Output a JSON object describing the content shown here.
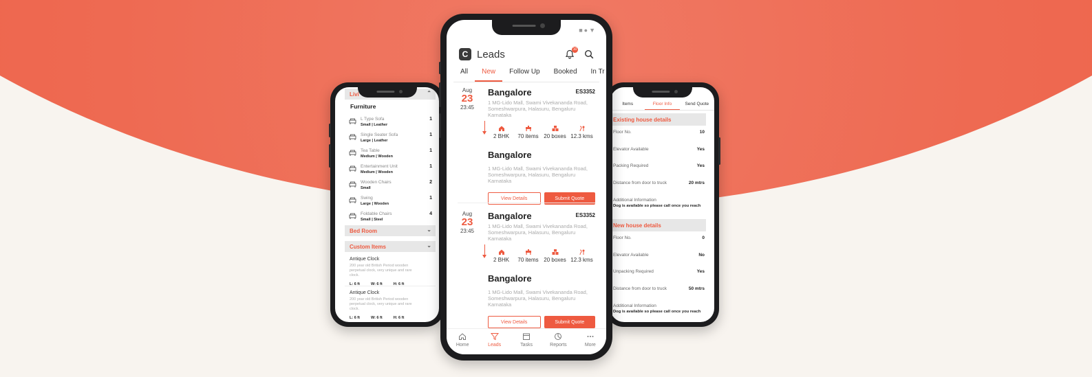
{
  "main": {
    "app_title": "Leads",
    "logo_letter": "C",
    "notification_count": "10",
    "tabs": [
      {
        "label": "All",
        "active": false
      },
      {
        "label": "New",
        "active": true
      },
      {
        "label": "Follow Up",
        "active": false
      },
      {
        "label": "Booked",
        "active": false
      },
      {
        "label": "In Tr",
        "active": false
      }
    ],
    "leads": [
      {
        "month": "Aug",
        "day": "23",
        "time": "23:45",
        "from_city": "Bangalore",
        "code": "ES3352",
        "from_address": "1 MG-Lido Mall, Swami Vivekananda Road, Someshwarpura, Halasuru, Bengaluru Karnataka",
        "stats": [
          "2 BHK",
          "70 items",
          "20 boxes",
          "12.3 kms"
        ],
        "to_city": "Bangalore",
        "to_address": "1 MG-Lido Mall, Swami Vivekananda Road, Someshwarpura, Halasuru, Bengaluru Karnataka",
        "view_label": "View Details",
        "quote_label": "Submit Quote"
      },
      {
        "month": "Aug",
        "day": "23",
        "time": "23:45",
        "from_city": "Bangalore",
        "code": "ES3352",
        "from_address": "1 MG-Lido Mall, Swami Vivekananda Road, Someshwarpura, Halasuru, Bengaluru Karnataka",
        "stats": [
          "2 BHK",
          "70 items",
          "20 boxes",
          "12.3 kms"
        ],
        "to_city": "Bangalore",
        "to_address": "1 MG-Lido Mall, Swami Vivekananda Road, Someshwarpura, Halasuru, Bengaluru Karnataka",
        "view_label": "View Details",
        "quote_label": "Submit Quote"
      }
    ],
    "nav": [
      {
        "label": "Home",
        "icon": "home-icon",
        "active": false
      },
      {
        "label": "Leads",
        "icon": "funnel-icon",
        "active": true
      },
      {
        "label": "Tasks",
        "icon": "calendar-icon",
        "active": false
      },
      {
        "label": "Reports",
        "icon": "chart-icon",
        "active": false
      },
      {
        "label": "More",
        "icon": "more-icon",
        "active": false
      }
    ]
  },
  "left": {
    "top_section": "Livi",
    "furniture_title": "Furniture",
    "items": [
      {
        "name": "L Type Sofa",
        "detail": "Small | Leather",
        "qty": "1"
      },
      {
        "name": "Single Seater Sofa",
        "detail": "Large | Leather",
        "qty": "1"
      },
      {
        "name": "Tea Table",
        "detail": "Medium | Wooden",
        "qty": "1"
      },
      {
        "name": "Entertainment Unit",
        "detail": "Medium | Wooden",
        "qty": "1"
      },
      {
        "name": "Wooden Chairs",
        "detail": "Small",
        "qty": "2"
      },
      {
        "name": "Swing",
        "detail": "Large | Wooden",
        "qty": "1"
      },
      {
        "name": "Foldable Chairs",
        "detail": "Small | Steel",
        "qty": "4"
      }
    ],
    "bed_room": "Bed Room",
    "custom_items": "Custom Items",
    "custom": [
      {
        "name": "Antique Clock",
        "desc": "200 year old British Period wooden perpetual clock, very unique and rare clock.",
        "l": "L: 6 ft",
        "w": "W: 6 ft",
        "h": "H: 6 ft"
      },
      {
        "name": "Antique Clock",
        "desc": "200 year old British Period wooden perpetual clock, very unique and rare clock.",
        "l": "L: 6 ft",
        "w": "W: 6 ft",
        "h": "H: 6 ft"
      }
    ]
  },
  "right": {
    "tabs": [
      {
        "label": "Items",
        "active": false
      },
      {
        "label": "Floor Info",
        "active": true
      },
      {
        "label": "Send Quote",
        "active": false
      }
    ],
    "existing_title": "Existing house details",
    "existing": [
      {
        "label": "Floor No.",
        "value": "10"
      },
      {
        "label": "Elevator Available",
        "value": "Yes"
      },
      {
        "label": "Packing Required",
        "value": "Yes"
      },
      {
        "label": "Distance from door to truck",
        "value": "20 mtrs"
      }
    ],
    "existing_info_label": "Additional Information",
    "existing_info_text": "Dog is available so please call once you reach",
    "new_title": "New house details",
    "new": [
      {
        "label": "Floor No.",
        "value": "0"
      },
      {
        "label": "Elevator Available",
        "value": "No"
      },
      {
        "label": "Unpacking Required",
        "value": "Yes"
      },
      {
        "label": "Distance from door to truck",
        "value": "50 mtrs"
      }
    ],
    "new_info_label": "Additional Information",
    "new_info_text": "Dog is available so please call once you reach"
  },
  "colors": {
    "accent": "#ee5a40",
    "background_arc": "#ec5f46",
    "page_bg": "#f8f4ef"
  }
}
